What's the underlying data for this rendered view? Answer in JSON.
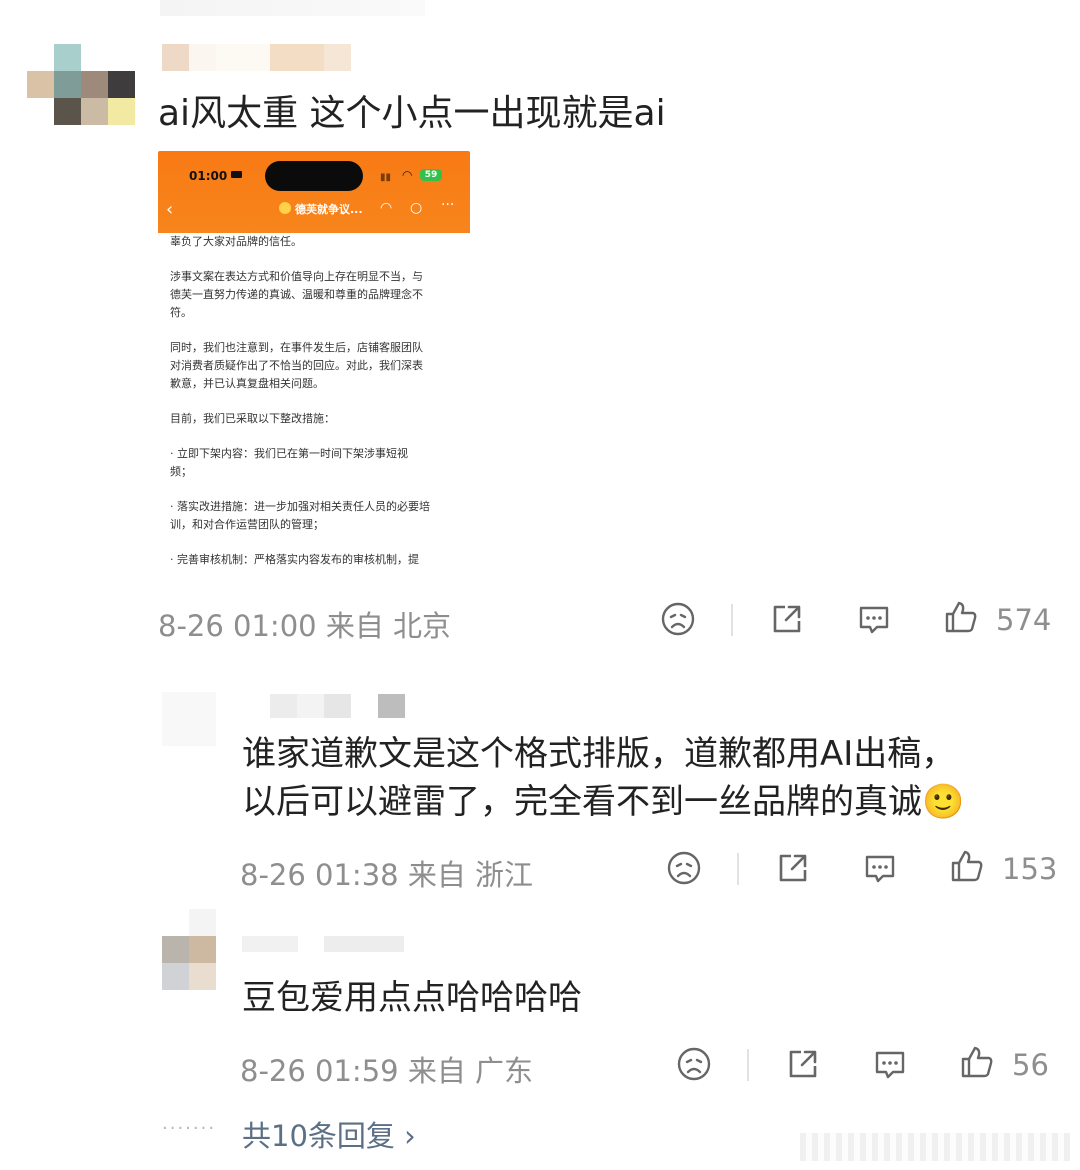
{
  "comments": [
    {
      "text": "ai风太重 这个小点一出现就是ai",
      "meta": "8-26 01:00  来自 北京",
      "likes": "574"
    },
    {
      "text_line1": "谁家道歉文是这个格式排版，道歉都用AI出稿，",
      "text_line2": "以后可以避雷了，完全看不到一丝品牌的真诚🙂",
      "meta": "8-26 01:38  来自 浙江",
      "likes": "153"
    },
    {
      "text": "豆包爱用点点哈哈哈哈",
      "meta": "8-26 01:59  来自 广东",
      "likes": "56"
    }
  ],
  "screenshot": {
    "time": "01:00",
    "battery": "59",
    "title": "德芙就争议...",
    "lines": [
      "辜负了大家对品牌的信任。",
      "",
      "涉事文案在表达方式和价值导向上存在明显不当，与",
      "德芙一直努力传递的真诚、温暖和尊重的品牌理念不",
      "符。",
      "",
      "同时，我们也注意到，在事件发生后，店铺客服团队",
      "对消费者质疑作出了不恰当的回应。对此，我们深表",
      "歉意，并已认真复盘相关问题。",
      "",
      "目前，我们已采取以下整改措施：",
      "",
      "· 立即下架内容：我们已在第一时间下架涉事短视",
      "频；",
      "",
      "· 落实改进措施：进一步加强对相关责任人员的必要培",
      "训，和对合作运营团队的管理；",
      "",
      "· 完善审核机制：严格落实内容发布的审核机制，提"
    ]
  },
  "replies_link": "共10条回复 ›",
  "icons": [
    "sad-face-icon",
    "share-icon",
    "comment-icon",
    "like-icon"
  ]
}
